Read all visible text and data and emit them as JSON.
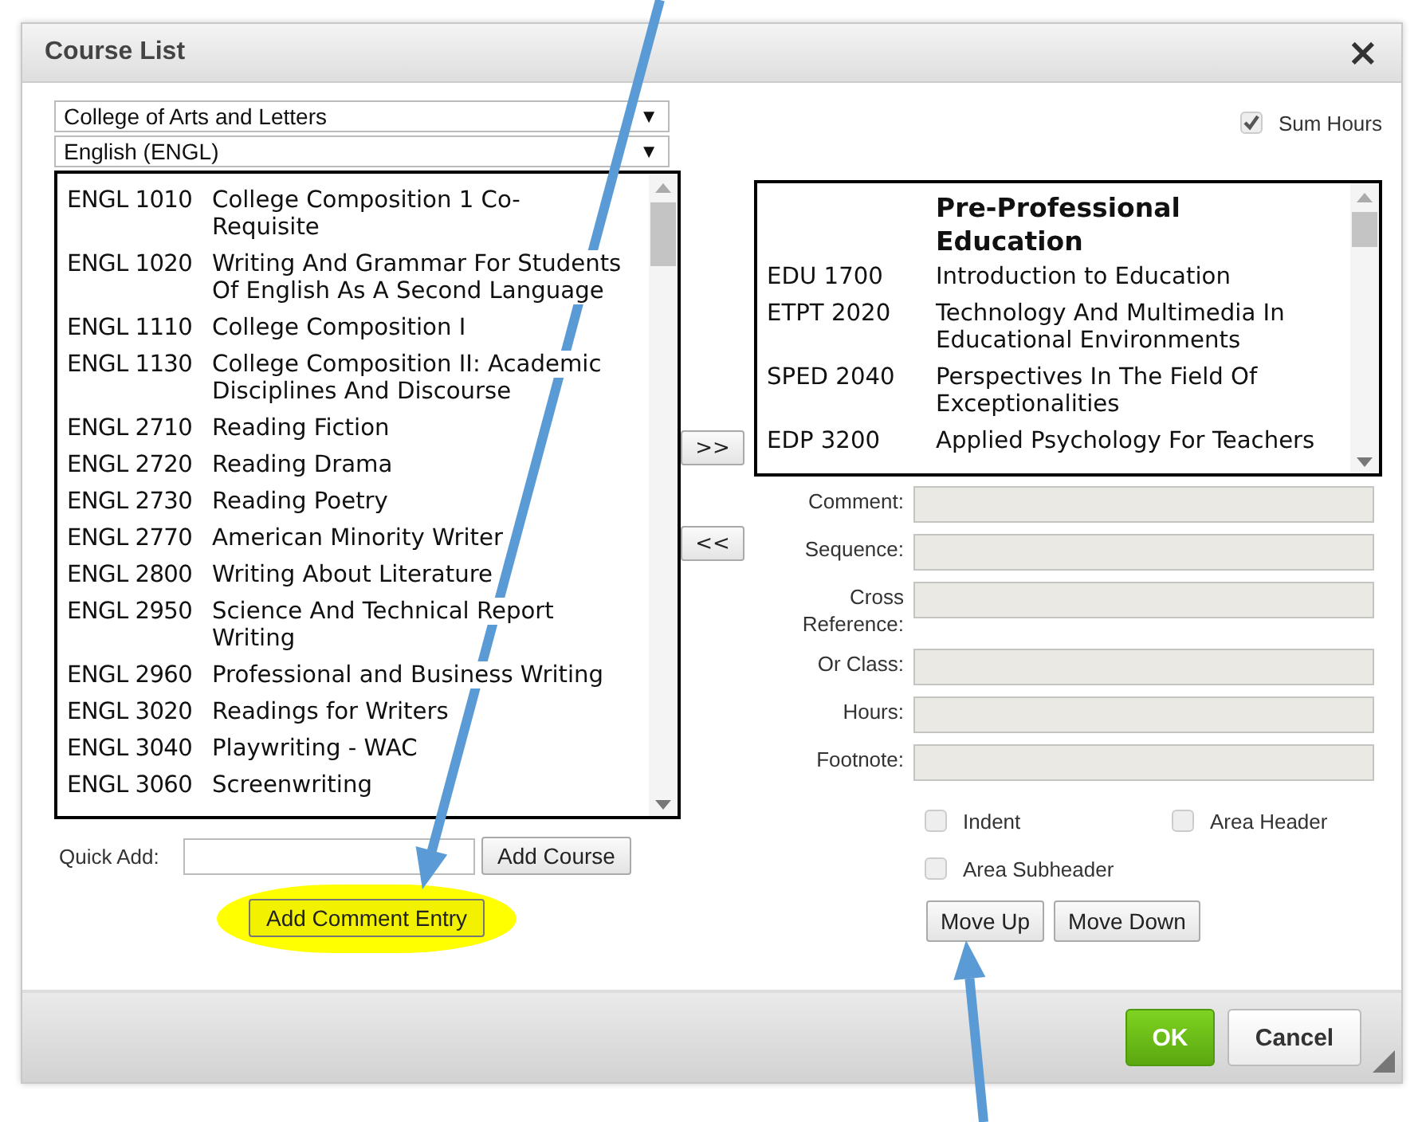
{
  "window": {
    "title": "Course List",
    "close": "×"
  },
  "college_select": {
    "value": "College of Arts and Letters",
    "arrow": "▼"
  },
  "subject_select": {
    "value": "English (ENGL)",
    "arrow": "▼"
  },
  "course_list": [
    {
      "code": "ENGL 1010",
      "title": "College Composition 1 Co-Requisite"
    },
    {
      "code": "ENGL 1020",
      "title": "Writing And Grammar For Students Of English As A Second Language"
    },
    {
      "code": "ENGL 1110",
      "title": "College Composition I"
    },
    {
      "code": "ENGL 1130",
      "title": "College Composition II: Academic Disciplines And Discourse"
    },
    {
      "code": "ENGL 2710",
      "title": "Reading Fiction"
    },
    {
      "code": "ENGL 2720",
      "title": "Reading Drama"
    },
    {
      "code": "ENGL 2730",
      "title": "Reading Poetry"
    },
    {
      "code": "ENGL 2770",
      "title": "American Minority Writer"
    },
    {
      "code": "ENGL 2800",
      "title": "Writing About Literature"
    },
    {
      "code": "ENGL 2950",
      "title": "Science And Technical Report Writing"
    },
    {
      "code": "ENGL 2960",
      "title": "Professional and Business Writing"
    },
    {
      "code": "ENGL 3020",
      "title": "Readings for Writers"
    },
    {
      "code": "ENGL 3040",
      "title": "Playwriting - WAC"
    },
    {
      "code": "ENGL 3060",
      "title": "Screenwriting"
    }
  ],
  "transfer_buttons": [
    ">>",
    "<<"
  ],
  "sum_hours": {
    "label": "Sum Hours",
    "checked": true
  },
  "selected_list": {
    "header": "Pre-Professional Education",
    "rows": [
      {
        "code": "EDU 1700",
        "title": "Introduction to Education"
      },
      {
        "code": "ETPT 2020",
        "title": "Technology And Multimedia In Educational Environments"
      },
      {
        "code": "SPED 2040",
        "title": "Perspectives In The Field Of Exceptionalities"
      },
      {
        "code": "EDP 3200",
        "title": "Applied Psychology For Teachers"
      }
    ]
  },
  "fields": [
    {
      "label": "Comment:"
    },
    {
      "label": "Sequence:"
    },
    {
      "label": "Cross Reference:"
    },
    {
      "label": "Or Class:"
    },
    {
      "label": "Hours:"
    },
    {
      "label": "Footnote:"
    }
  ],
  "options": [
    {
      "label": "Indent",
      "checked": false
    },
    {
      "label": "Area Header",
      "checked": false
    },
    {
      "label": "Area Subheader",
      "checked": false
    }
  ],
  "order_buttons": [
    "Move Up",
    "Move Down"
  ],
  "quick_add": {
    "label": "Quick Add:",
    "button": "Add Course"
  },
  "comment_button": {
    "label": "Add Comment Entry",
    "highlighted": true
  },
  "footer": {
    "ok": "OK",
    "cancel": "Cancel"
  }
}
